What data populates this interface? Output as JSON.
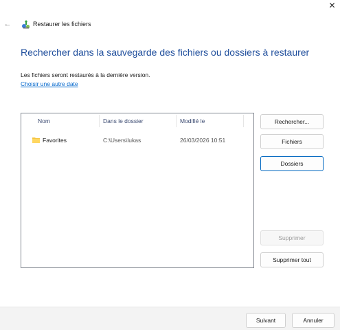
{
  "window": {
    "title": "Restaurer les fichiers",
    "close_glyph": "✕",
    "back_glyph": "←"
  },
  "content": {
    "heading": "Rechercher dans la sauvegarde des fichiers ou dossiers à restaurer",
    "info": "Les fichiers seront restaurés à la dernière version.",
    "date_link": "Choisir une autre date"
  },
  "list": {
    "columns": {
      "name": "Nom",
      "folder": "Dans le dossier",
      "modified": "Modifié le"
    },
    "rows": [
      {
        "name": "Favorites",
        "folder": "C:\\Users\\lukas",
        "modified": "26/03/2026 10:51"
      }
    ]
  },
  "side_buttons": {
    "search": "Rechercher...",
    "files": "Fichiers",
    "folders": "Dossiers",
    "remove": "Supprimer",
    "remove_all": "Supprimer tout"
  },
  "footer": {
    "next": "Suivant",
    "cancel": "Annuler"
  },
  "colors": {
    "heading": "#1f4e9c",
    "link": "#0066cc",
    "focus": "#0067c0",
    "folder": "#f5c542"
  },
  "icons": {
    "app": "restore-files-icon",
    "folder": "folder-icon",
    "back": "back-arrow-icon",
    "close": "close-icon"
  }
}
